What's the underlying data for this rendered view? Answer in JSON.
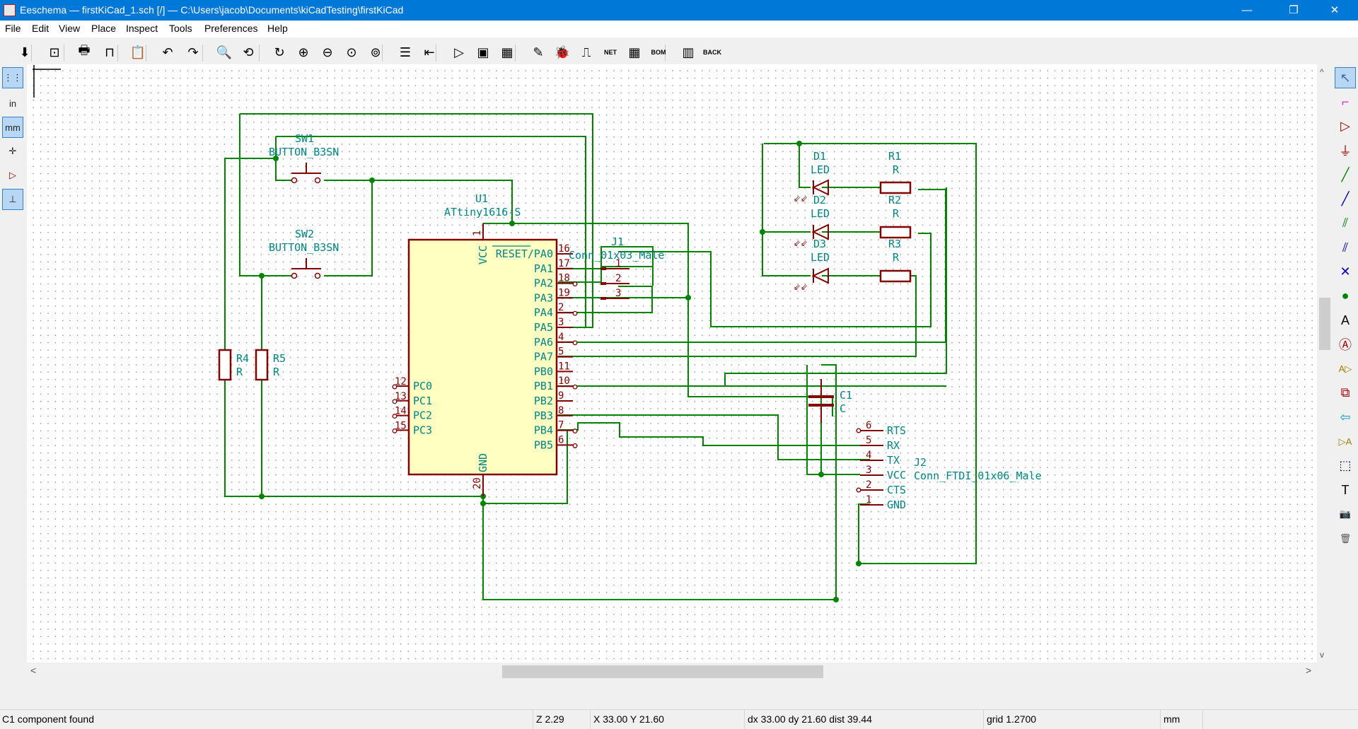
{
  "window": {
    "title": "Eeschema — firstKiCad_1.sch [/] — C:\\Users\\jacob\\Documents\\kiCadTesting\\firstKiCad",
    "minimize_glyph": "—",
    "restore_glyph": "❐",
    "close_glyph": "✕"
  },
  "menubar": [
    "File",
    "Edit",
    "View",
    "Place",
    "Inspect",
    "Tools",
    "Preferences",
    "Help"
  ],
  "toolbar": {
    "items": [
      {
        "name": "save-icon",
        "glyph": "⬇"
      },
      {
        "name": "page-settings-icon",
        "glyph": "⊡"
      },
      {
        "name": "print-icon",
        "glyph": "🖶"
      },
      {
        "name": "plot-icon",
        "glyph": "⊓"
      },
      {
        "name": "paste-icon",
        "glyph": "📋"
      },
      {
        "name": "undo-icon",
        "glyph": "↶"
      },
      {
        "name": "redo-icon",
        "glyph": "↷"
      },
      {
        "name": "find-icon",
        "glyph": "🔍"
      },
      {
        "name": "find-replace-icon",
        "glyph": "⟲"
      },
      {
        "name": "redraw-icon",
        "glyph": "↻"
      },
      {
        "name": "zoom-in-icon",
        "glyph": "⊕"
      },
      {
        "name": "zoom-out-icon",
        "glyph": "⊖"
      },
      {
        "name": "zoom-fit-icon",
        "glyph": "⊙"
      },
      {
        "name": "zoom-selection-icon",
        "glyph": "⊚"
      },
      {
        "name": "hierarchy-navigator-icon",
        "glyph": "☰"
      },
      {
        "name": "leave-sheet-icon",
        "glyph": "⇤"
      },
      {
        "name": "symbol-editor-icon",
        "glyph": "▷"
      },
      {
        "name": "symbol-browser-icon",
        "glyph": "▣"
      },
      {
        "name": "annotate-icon",
        "glyph": "▦"
      },
      {
        "name": "edit-fields-icon",
        "glyph": "✎"
      },
      {
        "name": "erc-icon",
        "glyph": "🐞"
      },
      {
        "name": "footprint-assign-icon",
        "glyph": "⎍"
      },
      {
        "name": "netlist-icon",
        "glyph": "NET"
      },
      {
        "name": "bom-table-icon",
        "glyph": "▦"
      },
      {
        "name": "bom-icon",
        "glyph": "BOM"
      },
      {
        "name": "pcbnew-icon",
        "glyph": "▥"
      },
      {
        "name": "back-annotate-icon",
        "glyph": "BACK"
      }
    ]
  },
  "left_toolbar": [
    {
      "name": "grid-toggle-icon",
      "glyph": "⋮⋮",
      "active": true
    },
    {
      "name": "units-inch-icon",
      "glyph": "in",
      "active": false
    },
    {
      "name": "units-mm-icon",
      "glyph": "mm",
      "active": true
    },
    {
      "name": "cursor-shape-icon",
      "glyph": "✛",
      "active": false
    },
    {
      "name": "hidden-pins-icon",
      "glyph": "▷",
      "active": false
    },
    {
      "name": "orthogonal-wire-icon",
      "glyph": "⊥",
      "active": true
    }
  ],
  "right_toolbar": [
    {
      "name": "select-arrow-icon",
      "glyph": "↖",
      "active": true,
      "color": "#3a6ea5"
    },
    {
      "name": "highlight-net-icon",
      "glyph": "⌐",
      "active": false,
      "color": "#e020e0"
    },
    {
      "name": "add-symbol-icon",
      "glyph": "▷",
      "active": false,
      "color": "#a00000"
    },
    {
      "name": "add-power-icon",
      "glyph": "⏚",
      "active": false,
      "color": "#a00000"
    },
    {
      "name": "add-wire-icon",
      "glyph": "╱",
      "active": false,
      "color": "#008400"
    },
    {
      "name": "add-bus-icon",
      "glyph": "╱",
      "active": false,
      "color": "#0000c0"
    },
    {
      "name": "wire-bus-entry-icon",
      "glyph": "⫽",
      "active": false,
      "color": "#008400"
    },
    {
      "name": "bus-bus-entry-icon",
      "glyph": "⫽",
      "active": false,
      "color": "#0000c0"
    },
    {
      "name": "no-connect-icon",
      "glyph": "✕",
      "active": false,
      "color": "#0000c0"
    },
    {
      "name": "add-junction-icon",
      "glyph": "●",
      "active": false,
      "color": "#008400"
    },
    {
      "name": "add-label-icon",
      "glyph": "A",
      "active": false,
      "color": "#000000"
    },
    {
      "name": "add-global-label-icon",
      "glyph": "Ⓐ",
      "active": false,
      "color": "#a00000"
    },
    {
      "name": "add-hierarchical-label-icon",
      "glyph": "A▷",
      "active": false,
      "color": "#a08000"
    },
    {
      "name": "add-sheet-icon",
      "glyph": "⧉",
      "active": false,
      "color": "#a00000"
    },
    {
      "name": "import-sheet-pin-icon",
      "glyph": "⇦",
      "active": false,
      "color": "#00a0c0"
    },
    {
      "name": "add-sheet-pin-icon",
      "glyph": "▷A",
      "active": false,
      "color": "#a08000"
    },
    {
      "name": "add-graphic-lines-icon",
      "glyph": "⬚",
      "active": false,
      "color": "#000080"
    },
    {
      "name": "add-text-icon",
      "glyph": "T",
      "active": false,
      "color": "#000000"
    },
    {
      "name": "add-image-icon",
      "glyph": "📷",
      "active": false,
      "color": "#000000"
    },
    {
      "name": "delete-icon",
      "glyph": "🗑",
      "active": false,
      "color": "#555555"
    }
  ],
  "scrollbars": {
    "up": "^",
    "down": "v",
    "left": "<",
    "right": ">"
  },
  "schematic": {
    "u1": {
      "ref": "U1",
      "value": "ATtiny1616-S",
      "vcc_pin": "1",
      "vcc_name": "VCC",
      "gnd_pin": "20",
      "gnd_name": "GND",
      "right_pins": [
        {
          "num": "16",
          "name": "RESET/PA0"
        },
        {
          "num": "17",
          "name": "PA1"
        },
        {
          "num": "18",
          "name": "PA2"
        },
        {
          "num": "19",
          "name": "PA3"
        },
        {
          "num": "2",
          "name": "PA4"
        },
        {
          "num": "3",
          "name": "PA5"
        },
        {
          "num": "4",
          "name": "PA6"
        },
        {
          "num": "5",
          "name": "PA7"
        },
        {
          "num": "11",
          "name": "PB0"
        },
        {
          "num": "10",
          "name": "PB1"
        },
        {
          "num": "9",
          "name": "PB2"
        },
        {
          "num": "8",
          "name": "PB3"
        },
        {
          "num": "7",
          "name": "PB4"
        },
        {
          "num": "6",
          "name": "PB5"
        }
      ],
      "left_pins": [
        {
          "num": "12",
          "name": "PC0"
        },
        {
          "num": "13",
          "name": "PC1"
        },
        {
          "num": "14",
          "name": "PC2"
        },
        {
          "num": "15",
          "name": "PC3"
        }
      ]
    },
    "sw1": {
      "ref": "SW1",
      "value": "BUTTON_B3SN"
    },
    "sw2": {
      "ref": "SW2",
      "value": "BUTTON_B3SN"
    },
    "r4": {
      "ref": "R4",
      "value": "R"
    },
    "r5": {
      "ref": "R5",
      "value": "R"
    },
    "j1": {
      "ref": "J1",
      "value": "Conn_01x03_Male",
      "pins": [
        "1",
        "2",
        "3"
      ]
    },
    "d1": {
      "ref": "D1",
      "value": "LED"
    },
    "d2": {
      "ref": "D2",
      "value": "LED"
    },
    "d3": {
      "ref": "D3",
      "value": "LED"
    },
    "r1": {
      "ref": "R1",
      "value": "R"
    },
    "r2": {
      "ref": "R2",
      "value": "R"
    },
    "r3": {
      "ref": "R3",
      "value": "R"
    },
    "c1": {
      "ref": "C1",
      "value": "C"
    },
    "j2": {
      "ref": "J2",
      "value": "Conn_FTDI_01x06_Male",
      "pins": [
        {
          "num": "6",
          "name": "RTS"
        },
        {
          "num": "5",
          "name": "RX"
        },
        {
          "num": "4",
          "name": "TX"
        },
        {
          "num": "3",
          "name": "VCC"
        },
        {
          "num": "2",
          "name": "CTS"
        },
        {
          "num": "1",
          "name": "GND"
        }
      ]
    }
  },
  "status": {
    "message": "C1 component found",
    "zoom": "Z 2.29",
    "position": "X 33.00  Y 21.60",
    "delta": "dx 33.00  dy 21.60  dist 39.44",
    "grid": "grid 1.2700",
    "units": "mm"
  },
  "colors": {
    "title_bar": "#0078d7",
    "wire": "#008400",
    "component": "#840000",
    "component_fill": "#ffffc2",
    "text": "#008484"
  }
}
